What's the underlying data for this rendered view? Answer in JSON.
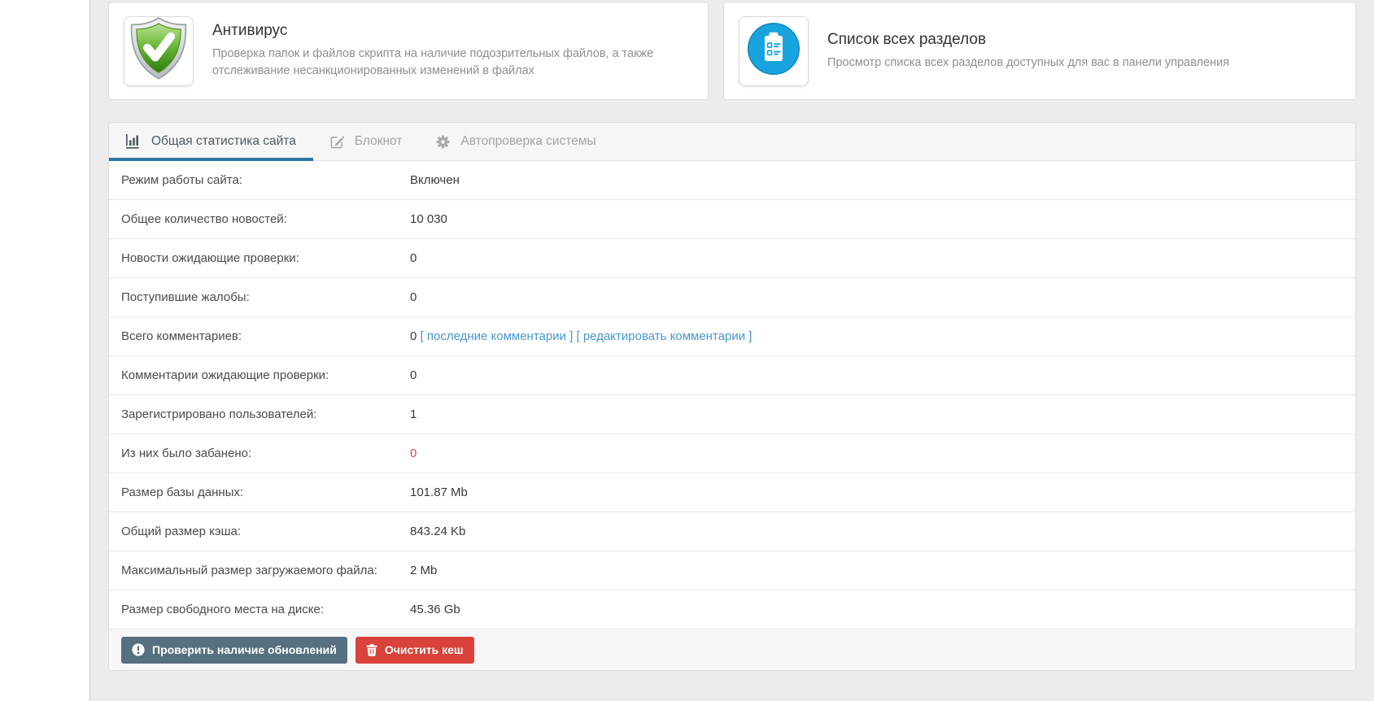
{
  "cards": [
    {
      "title": "Антивирус",
      "description": "Проверка папок и файлов скрипта на наличие подозрительных файлов, а также отслеживание несанкционированных изменений в файлах",
      "icon": "antivirus-shield-icon"
    },
    {
      "title": "Список всех разделов",
      "description": "Просмотр списка всех разделов доступных для вас в панели управления",
      "icon": "sections-list-icon"
    }
  ],
  "tabs": [
    {
      "label": "Общая статистика сайта",
      "icon": "bar-chart-icon",
      "active": true
    },
    {
      "label": "Блокнот",
      "icon": "notepad-edit-icon",
      "active": false
    },
    {
      "label": "Автопроверка системы",
      "icon": "gear-icon",
      "active": false
    }
  ],
  "stats": {
    "rows": [
      {
        "label": "Режим работы сайта:",
        "value": "Включен"
      },
      {
        "label": "Общее количество новостей:",
        "value": "10 030"
      },
      {
        "label": "Новости ожидающие проверки:",
        "value": "0"
      },
      {
        "label": "Поступившие жалобы:",
        "value": "0"
      },
      {
        "label": "Всего комментариев:",
        "value": "0",
        "links": [
          "последние комментарии",
          "редактировать комментарии"
        ]
      },
      {
        "label": "Комментарии ожидающие проверки:",
        "value": "0"
      },
      {
        "label": "Зарегистрировано пользователей:",
        "value": "1"
      },
      {
        "label": "Из них было забанено:",
        "value": "0",
        "value_color": "danger"
      },
      {
        "label": "Размер базы данных:",
        "value": "101.87 Mb"
      },
      {
        "label": "Общий размер кэша:",
        "value": "843.24 Kb"
      },
      {
        "label": "Максимальный размер загружаемого файла:",
        "value": "2 Mb"
      },
      {
        "label": "Размер свободного места на диске:",
        "value": "45.36 Gb"
      }
    ]
  },
  "footer": {
    "check_updates_label": "Проверить наличие обновлений",
    "clear_cache_label": "Очистить кеш"
  },
  "colors": {
    "accent_tab_underline": "#2e76a4",
    "link": "#4796cf",
    "danger": "#dc4a45",
    "button_update_bg": "#56707f",
    "button_clear_bg": "#d9433b",
    "antivirus_green": "#55a527",
    "sections_blue": "#19a3de"
  }
}
